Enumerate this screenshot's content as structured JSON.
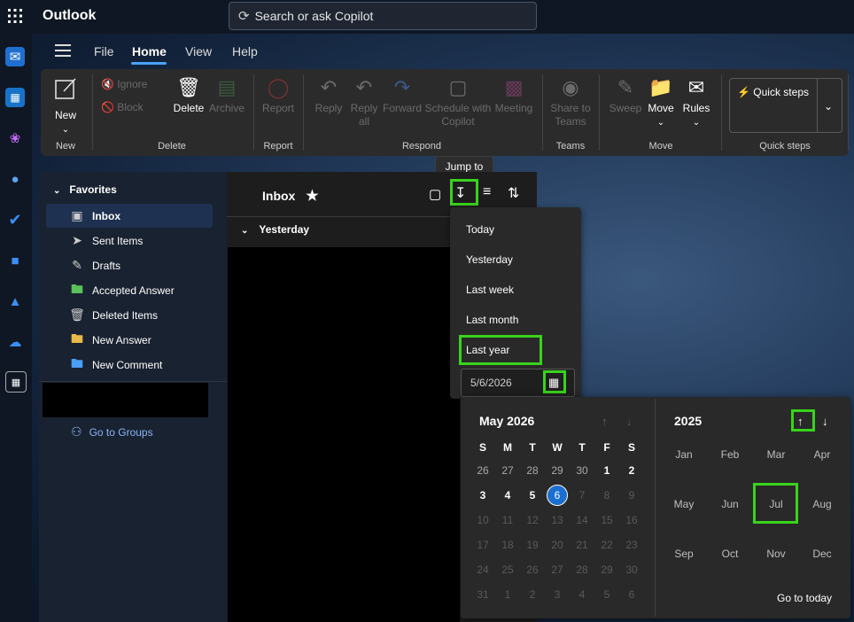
{
  "app": {
    "title": "Outlook"
  },
  "search": {
    "placeholder": "Search or ask Copilot"
  },
  "menu_tabs": [
    "File",
    "Home",
    "View",
    "Help"
  ],
  "ribbon": {
    "new": "New",
    "ignore": "Ignore",
    "block": "Block",
    "delete": "Delete",
    "archive": "Archive",
    "report": "Report",
    "reply": "Reply",
    "reply_all_1": "Reply",
    "reply_all_2": "all",
    "forward": "Forward",
    "schedule_1": "Schedule with",
    "schedule_2": "Copilot",
    "meeting": "Meeting",
    "share_1": "Share to",
    "share_2": "Teams",
    "sweep": "Sweep",
    "move": "Move",
    "rules": "Rules",
    "quick_steps": "Quick steps",
    "groups": {
      "new": "New",
      "delete": "Delete",
      "report": "Report",
      "respond": "Respond",
      "teams": "Teams",
      "move": "Move",
      "quick_steps": "Quick steps"
    }
  },
  "tooltip": "Jump to",
  "folders": {
    "favorites": "Favorites",
    "items": [
      "Inbox",
      "Sent Items",
      "Drafts",
      "Accepted Answer",
      "Deleted Items",
      "New Answer",
      "New Comment"
    ],
    "go_to_groups": "Go to Groups"
  },
  "message_list": {
    "title": "Inbox",
    "group": "Yesterday"
  },
  "jump_menu": {
    "items": [
      "Today",
      "Yesterday",
      "Last week",
      "Last month",
      "Last year"
    ],
    "date_value": "5/6/2026"
  },
  "calendar": {
    "month_title": "May 2026",
    "weekdays": [
      "S",
      "M",
      "T",
      "W",
      "T",
      "F",
      "S"
    ],
    "weeks": [
      [
        "26",
        "27",
        "28",
        "29",
        "30",
        "1",
        "2"
      ],
      [
        "3",
        "4",
        "5",
        "6",
        "7",
        "8",
        "9"
      ],
      [
        "10",
        "11",
        "12",
        "13",
        "14",
        "15",
        "16"
      ],
      [
        "17",
        "18",
        "19",
        "20",
        "21",
        "22",
        "23"
      ],
      [
        "24",
        "25",
        "26",
        "27",
        "28",
        "29",
        "30"
      ],
      [
        "31",
        "1",
        "2",
        "3",
        "4",
        "5",
        "6"
      ]
    ],
    "selected_day": "6",
    "year_title": "2025",
    "months": [
      "Jan",
      "Feb",
      "Mar",
      "Apr",
      "May",
      "Jun",
      "Jul",
      "Aug",
      "Sep",
      "Oct",
      "Nov",
      "Dec"
    ],
    "go_to_today": "Go to today"
  },
  "colors": {
    "accent": "#1a6fd0",
    "highlight": "#39d31c"
  }
}
